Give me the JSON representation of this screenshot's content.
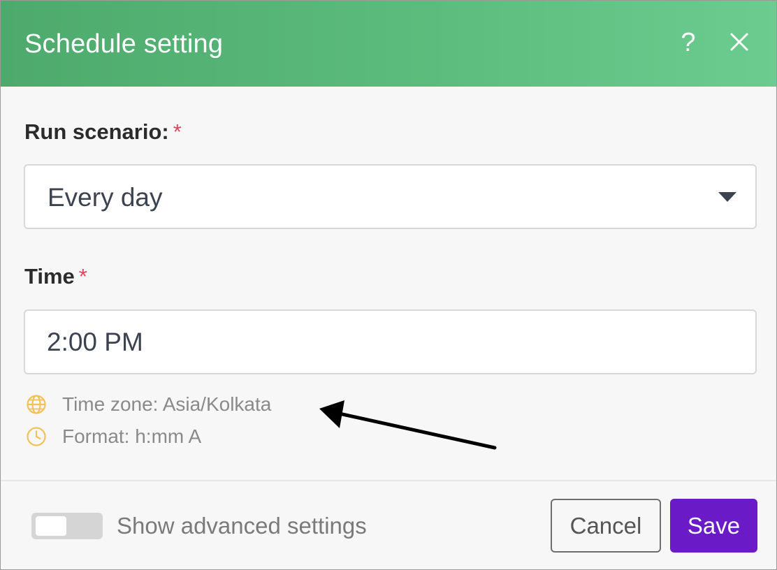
{
  "dialog": {
    "title": "Schedule setting",
    "help_label": "?",
    "header_colors": [
      "#4daa6c",
      "#6ccb8f"
    ]
  },
  "run_scenario": {
    "label": "Run scenario:",
    "required_mark": "*",
    "selected": "Every day"
  },
  "time": {
    "label": "Time",
    "required_mark": "*",
    "value": "2:00 PM"
  },
  "hints": {
    "timezone": {
      "icon": "globe-icon",
      "text": "Time zone: Asia/Kolkata"
    },
    "format": {
      "icon": "clock-icon",
      "text": "Format: h:mm A"
    }
  },
  "footer": {
    "toggle_label": "Show advanced settings",
    "toggle_on": false,
    "cancel_label": "Cancel",
    "save_label": "Save",
    "save_color": "#6a1bc7"
  },
  "annotation": {
    "icon": "arrow-icon",
    "color": "#000000"
  }
}
